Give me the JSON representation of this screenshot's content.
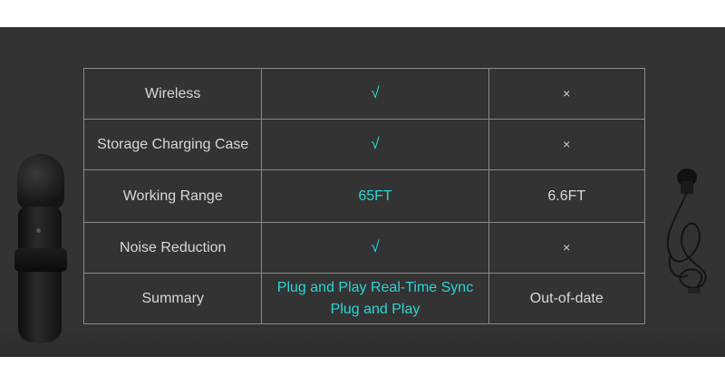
{
  "comparison": {
    "rows": [
      {
        "feature": "Wireless",
        "product": "√",
        "other": "×"
      },
      {
        "feature": "Storage Charging Case",
        "product": "√",
        "other": "×"
      },
      {
        "feature": "Working Range",
        "product": "65FT",
        "other": "6.6FT"
      },
      {
        "feature": "Noise Reduction",
        "product": "√",
        "other": "×"
      },
      {
        "feature": "Summary",
        "product_line1": "Plug and Play Real-Time Sync",
        "product_line2": "Plug and Play",
        "other": "Out-of-date"
      }
    ]
  },
  "colors": {
    "background_band": "#333333",
    "highlight": "#2ad6d6",
    "text": "#d8d8d8",
    "border": "#8a8a8a"
  },
  "images": {
    "left_product": "wireless-lavalier-microphone",
    "right_product": "wired-lavalier-microphone"
  }
}
